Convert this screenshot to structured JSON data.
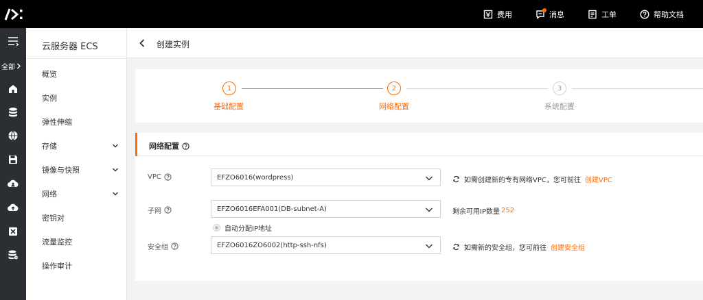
{
  "topbar": {
    "items": [
      {
        "label": "费用",
        "icon": "billing-icon"
      },
      {
        "label": "消息",
        "icon": "message-icon"
      },
      {
        "label": "工单",
        "icon": "ticket-icon"
      },
      {
        "label": "帮助文档",
        "icon": "help-icon"
      }
    ]
  },
  "rail": {
    "all_label": "全部"
  },
  "sidenav": {
    "title": "云服务器 ECS",
    "items": [
      {
        "label": "概览"
      },
      {
        "label": "实例"
      },
      {
        "label": "弹性伸缩"
      },
      {
        "label": "存储"
      },
      {
        "label": "镜像与快照"
      },
      {
        "label": "网络"
      },
      {
        "label": "密钥对"
      },
      {
        "label": "流量监控"
      },
      {
        "label": "操作审计"
      }
    ]
  },
  "header": {
    "title": "创建实例"
  },
  "steps": [
    {
      "num": "1",
      "label": "基础配置",
      "state": "done"
    },
    {
      "num": "2",
      "label": "网络配置",
      "state": "active"
    },
    {
      "num": "3",
      "label": "系统配置",
      "state": "pending"
    }
  ],
  "form": {
    "title": "网络配置",
    "vpc": {
      "label": "VPC",
      "value": "EFZO6016(wordpress)",
      "hint": "如需创建新的专有网络VPC，您可前往",
      "link": "创建VPC"
    },
    "subnet": {
      "label": "子网",
      "value": "EFZO6016EFA001(DB-subnet-A)",
      "hint": "剩余可用IP数量",
      "count": "252"
    },
    "auto_ip": {
      "label": "自动分配IP地址"
    },
    "security_group": {
      "label": "安全组",
      "value": "EFZO6016ZO6002(http-ssh-nfs)",
      "hint": "如需新的安全组，您可前往",
      "link": "创建安全组"
    }
  },
  "colors": {
    "accent": "#ff6a00",
    "topbar": "#000000",
    "rail": "#2b2f33"
  }
}
